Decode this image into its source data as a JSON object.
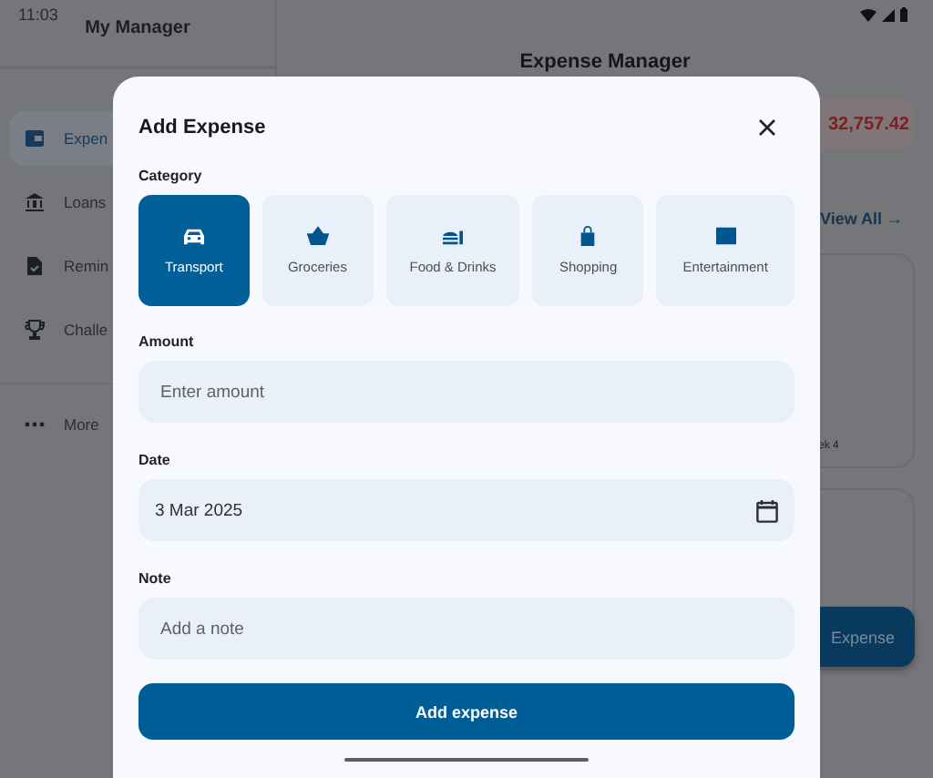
{
  "status_bar": {
    "time": "11:03"
  },
  "drawer": {
    "title": "My Manager",
    "items": [
      {
        "label": "Expen",
        "selected": true
      },
      {
        "label": "Loans",
        "selected": false
      },
      {
        "label": "Remin",
        "selected": false
      },
      {
        "label": "Challe",
        "selected": false
      }
    ],
    "more": "More"
  },
  "main": {
    "title": "Expense Manager",
    "balance": "32,757.42",
    "view_all": "View All →",
    "chart_label": "ek 4",
    "fab": "Expense"
  },
  "dialog": {
    "title": "Add Expense",
    "category_label": "Category",
    "categories": [
      {
        "label": "Transport",
        "selected": true
      },
      {
        "label": "Groceries",
        "selected": false
      },
      {
        "label": "Food & Drinks",
        "selected": false
      },
      {
        "label": "Shopping",
        "selected": false
      },
      {
        "label": "Entertainment",
        "selected": false
      }
    ],
    "fields": [
      {
        "kind": "text",
        "label": "Amount",
        "placeholder": "Enter amount"
      },
      {
        "kind": "date",
        "label": "Date",
        "value": "3 Mar 2025"
      },
      {
        "kind": "text",
        "label": "Note",
        "placeholder": "Add a note"
      }
    ],
    "submit": "Add expense"
  }
}
